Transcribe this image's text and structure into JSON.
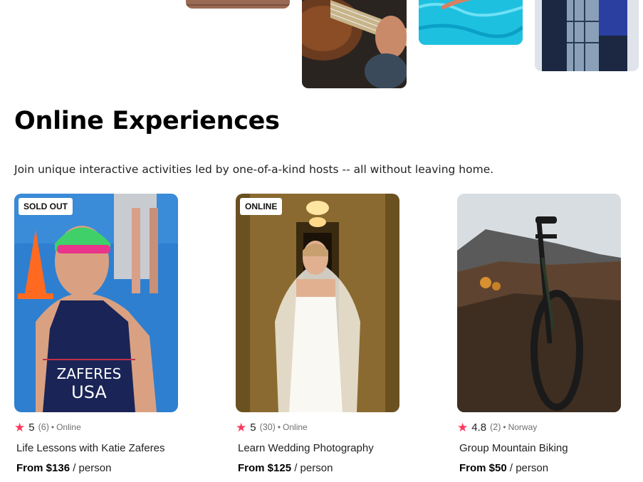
{
  "section": {
    "title": "Online Experiences",
    "description": "Join unique interactive activities led by one-of-a-kind hosts -- all without leaving home."
  },
  "top_photos": [
    {
      "name": "brick-photo"
    },
    {
      "name": "guitar-photo"
    },
    {
      "name": "pool-photo"
    },
    {
      "name": "jacket-photo"
    }
  ],
  "cards": [
    {
      "badge": "SOLD OUT",
      "rating": "5",
      "reviews": "(6)",
      "separator": "•",
      "location": "Online",
      "title": "Life Lessons with Katie Zaferes",
      "price": "From $136",
      "unit": "/ person",
      "jersey_top": "ZAFERES",
      "jersey_bottom": "USA"
    },
    {
      "badge": "ONLINE",
      "rating": "5",
      "reviews": "(30)",
      "separator": "•",
      "location": "Online",
      "title": "Learn Wedding Photography",
      "price": "From $125",
      "unit": "/ person"
    },
    {
      "badge": "",
      "rating": "4.8",
      "reviews": "(2)",
      "separator": "•",
      "location": "Norway",
      "title": "Group Mountain Biking",
      "price": "From $50",
      "unit": "/ person"
    }
  ],
  "colors": {
    "star": "#ff385c",
    "muted_text": "#717171",
    "heading": "#000000"
  },
  "icons": {
    "rating": "star-icon"
  }
}
